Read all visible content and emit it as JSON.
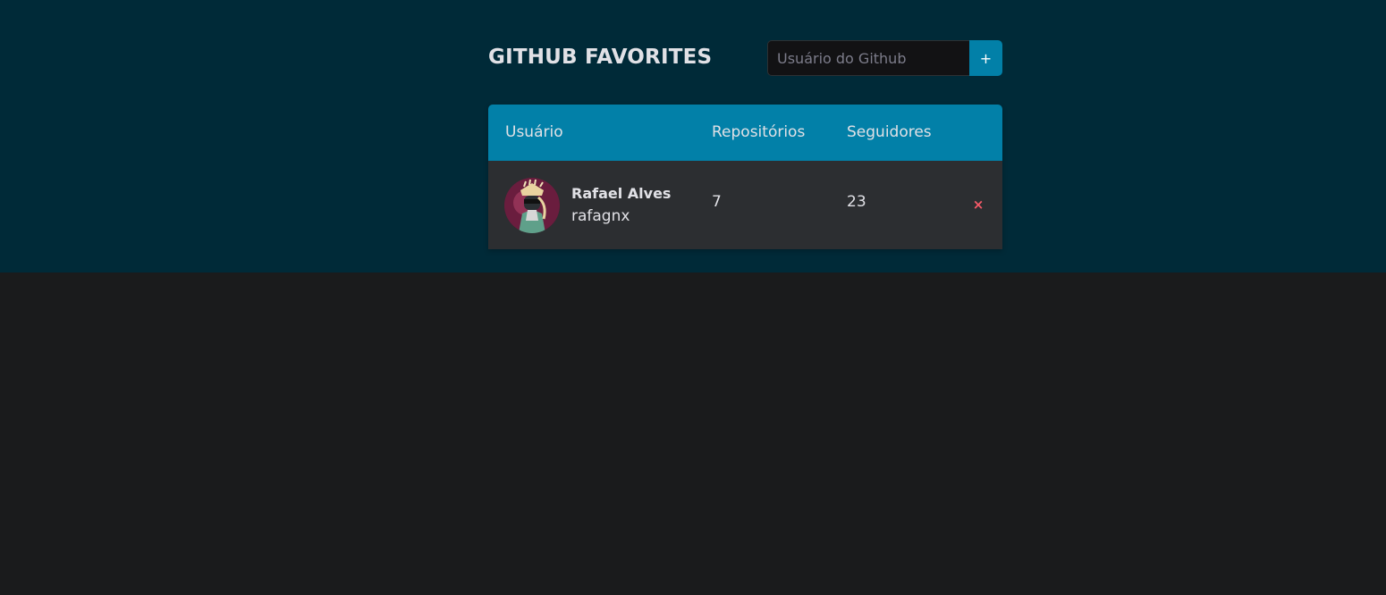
{
  "header": {
    "title": "GITHUB FAVORITES"
  },
  "search": {
    "placeholder": "Usuário do Github",
    "value": "",
    "add_label": "+"
  },
  "table": {
    "columns": {
      "user": "Usuário",
      "repositories": "Repositórios",
      "followers": "Seguidores"
    },
    "rows": [
      {
        "name": "Rafael Alves",
        "login": "rafagnx",
        "repositories": "7",
        "followers": "23",
        "remove_label": "×"
      }
    ]
  },
  "colors": {
    "hero_background": "#002a38",
    "page_background": "#1a1b1c",
    "accent": "#0280a8",
    "row_background": "#2c2e31",
    "danger": "#f75a68"
  }
}
